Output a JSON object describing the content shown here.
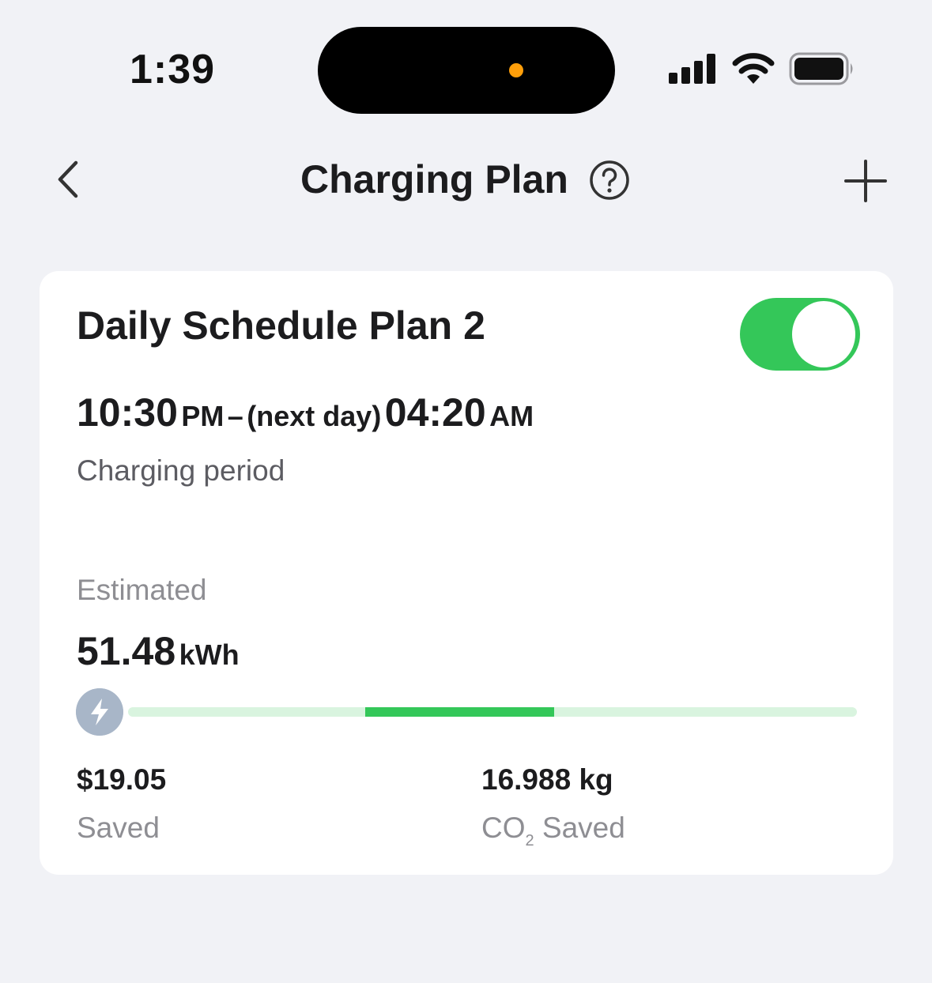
{
  "status_bar": {
    "time": "1:39",
    "camera_indicator_color": "#ff9f0a"
  },
  "nav": {
    "title": "Charging Plan",
    "back_icon": "chevron-left-icon",
    "help_icon": "question-circle-icon",
    "add_icon": "plus-icon"
  },
  "plan": {
    "name": "Daily Schedule Plan 2",
    "enabled": true,
    "start_time": "10:30",
    "start_period": "PM",
    "separator": "–",
    "next_day_note": "(next day)",
    "end_time": "04:20",
    "end_period": "AM",
    "period_label": "Charging period",
    "estimated_label": "Estimated",
    "energy_value": "51.48",
    "energy_unit": "kWh",
    "timeline": {
      "start_fraction": 0.325,
      "end_fraction": 0.585
    },
    "money_saved_value": "$19.05",
    "money_saved_label": "Saved",
    "co2_value": "16.988 kg",
    "co2_label_main": "CO",
    "co2_label_sub": "2",
    "co2_label_tail": "Saved"
  },
  "colors": {
    "accent_green": "#34c759",
    "track_light_green": "#d9f4df",
    "bolt_badge": "#a8b6c8",
    "background": "#f1f2f6"
  }
}
